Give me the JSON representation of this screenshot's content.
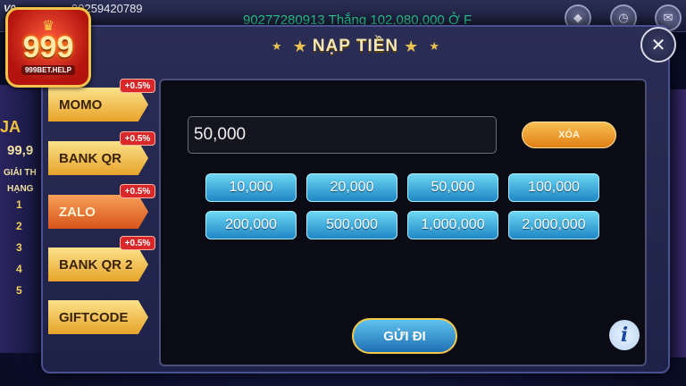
{
  "header": {
    "vip": "V0",
    "username": "90259420789",
    "ticker": "90277280913 Thắng 102,080,000 Ở F",
    "icons": [
      "diamond-icon",
      "clock-icon",
      "mail-icon"
    ]
  },
  "logo": {
    "number": "999",
    "site": "999BET.HELP"
  },
  "lobby": {
    "jackpot_prefix": "JA",
    "jackpot_value": "99,9",
    "label_1": "GIẢI TH",
    "label_2": "HẠNG",
    "ranks": [
      "1",
      "2",
      "3",
      "4",
      "5"
    ]
  },
  "dialog": {
    "title": "NẠP TIỀN",
    "close_icon": "close-icon"
  },
  "tabs": [
    {
      "label": "MOMO",
      "badge": "+0.5%",
      "active": false
    },
    {
      "label": "BANK QR",
      "badge": "+0.5%",
      "active": false
    },
    {
      "label": "ZALO",
      "badge": "+0.5%",
      "active": true
    },
    {
      "label": "BANK QR 2",
      "badge": "+0.5%",
      "active": false
    },
    {
      "label": "GIFTCODE",
      "badge": "",
      "active": false
    }
  ],
  "form": {
    "amount_value": "50,000",
    "clear_label": "XÓA",
    "amounts": [
      "10,000",
      "20,000",
      "50,000",
      "100,000",
      "200,000",
      "500,000",
      "1,000,000",
      "2,000,000"
    ],
    "submit_label": "GỬI ĐI",
    "info_icon": "info-icon"
  },
  "colors": {
    "tab_gold": "#f2c24a",
    "tab_active": "#e8702a",
    "amount_blue": "#3eaee0",
    "badge_red": "#d8282a"
  }
}
